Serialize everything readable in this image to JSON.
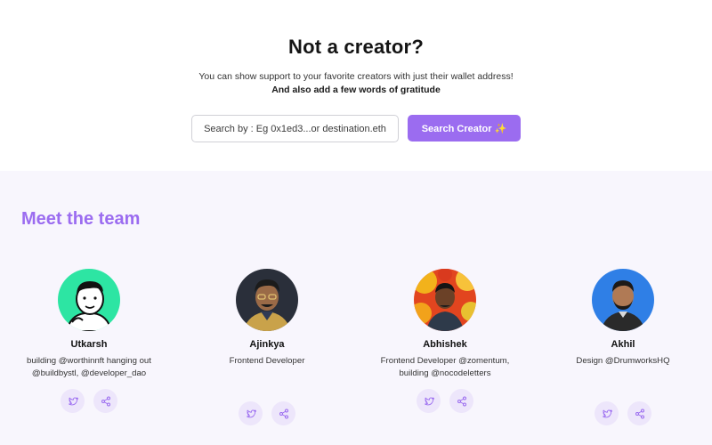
{
  "hero": {
    "title": "Not a creator?",
    "subtitle": "You can show support to your favorite creators with just their wallet address!",
    "subtitle_bold": "And also add a few words of gratitude",
    "search_placeholder": "Search by : Eg 0x1ed3...or destination.eth",
    "search_button": "Search Creator ✨"
  },
  "team": {
    "heading": "Meet the team",
    "members": [
      {
        "name": "Utkarsh",
        "bio": "building @worthinnft hanging out @buildbystl, @developer_dao"
      },
      {
        "name": "Ajinkya",
        "bio": "Frontend Developer"
      },
      {
        "name": "Abhishek",
        "bio": "Frontend Developer @zomentum, building @nocodeletters"
      },
      {
        "name": "Akhil",
        "bio": "Design @DrumworksHQ"
      }
    ]
  },
  "colors": {
    "accent": "#9b6cf0",
    "team_bg": "#f8f6fd",
    "icon_bg": "#ede6fb"
  },
  "icons": [
    "twitter-icon",
    "share-icon"
  ]
}
